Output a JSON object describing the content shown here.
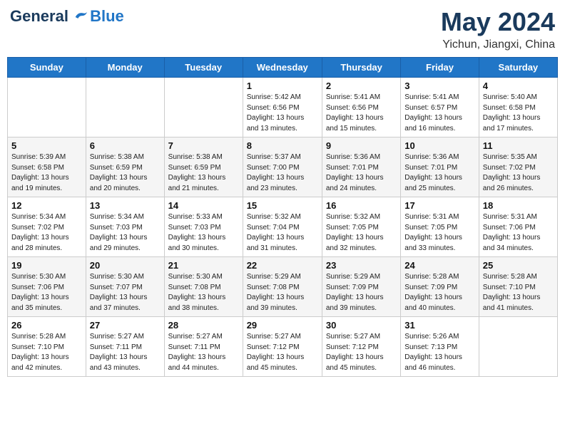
{
  "header": {
    "logo_line1": "General",
    "logo_line2": "Blue",
    "month": "May 2024",
    "location": "Yichun, Jiangxi, China"
  },
  "weekdays": [
    "Sunday",
    "Monday",
    "Tuesday",
    "Wednesday",
    "Thursday",
    "Friday",
    "Saturday"
  ],
  "weeks": [
    [
      {
        "day": "",
        "info": ""
      },
      {
        "day": "",
        "info": ""
      },
      {
        "day": "",
        "info": ""
      },
      {
        "day": "1",
        "info": "Sunrise: 5:42 AM\nSunset: 6:56 PM\nDaylight: 13 hours\nand 13 minutes."
      },
      {
        "day": "2",
        "info": "Sunrise: 5:41 AM\nSunset: 6:56 PM\nDaylight: 13 hours\nand 15 minutes."
      },
      {
        "day": "3",
        "info": "Sunrise: 5:41 AM\nSunset: 6:57 PM\nDaylight: 13 hours\nand 16 minutes."
      },
      {
        "day": "4",
        "info": "Sunrise: 5:40 AM\nSunset: 6:58 PM\nDaylight: 13 hours\nand 17 minutes."
      }
    ],
    [
      {
        "day": "5",
        "info": "Sunrise: 5:39 AM\nSunset: 6:58 PM\nDaylight: 13 hours\nand 19 minutes."
      },
      {
        "day": "6",
        "info": "Sunrise: 5:38 AM\nSunset: 6:59 PM\nDaylight: 13 hours\nand 20 minutes."
      },
      {
        "day": "7",
        "info": "Sunrise: 5:38 AM\nSunset: 6:59 PM\nDaylight: 13 hours\nand 21 minutes."
      },
      {
        "day": "8",
        "info": "Sunrise: 5:37 AM\nSunset: 7:00 PM\nDaylight: 13 hours\nand 23 minutes."
      },
      {
        "day": "9",
        "info": "Sunrise: 5:36 AM\nSunset: 7:01 PM\nDaylight: 13 hours\nand 24 minutes."
      },
      {
        "day": "10",
        "info": "Sunrise: 5:36 AM\nSunset: 7:01 PM\nDaylight: 13 hours\nand 25 minutes."
      },
      {
        "day": "11",
        "info": "Sunrise: 5:35 AM\nSunset: 7:02 PM\nDaylight: 13 hours\nand 26 minutes."
      }
    ],
    [
      {
        "day": "12",
        "info": "Sunrise: 5:34 AM\nSunset: 7:02 PM\nDaylight: 13 hours\nand 28 minutes."
      },
      {
        "day": "13",
        "info": "Sunrise: 5:34 AM\nSunset: 7:03 PM\nDaylight: 13 hours\nand 29 minutes."
      },
      {
        "day": "14",
        "info": "Sunrise: 5:33 AM\nSunset: 7:03 PM\nDaylight: 13 hours\nand 30 minutes."
      },
      {
        "day": "15",
        "info": "Sunrise: 5:32 AM\nSunset: 7:04 PM\nDaylight: 13 hours\nand 31 minutes."
      },
      {
        "day": "16",
        "info": "Sunrise: 5:32 AM\nSunset: 7:05 PM\nDaylight: 13 hours\nand 32 minutes."
      },
      {
        "day": "17",
        "info": "Sunrise: 5:31 AM\nSunset: 7:05 PM\nDaylight: 13 hours\nand 33 minutes."
      },
      {
        "day": "18",
        "info": "Sunrise: 5:31 AM\nSunset: 7:06 PM\nDaylight: 13 hours\nand 34 minutes."
      }
    ],
    [
      {
        "day": "19",
        "info": "Sunrise: 5:30 AM\nSunset: 7:06 PM\nDaylight: 13 hours\nand 35 minutes."
      },
      {
        "day": "20",
        "info": "Sunrise: 5:30 AM\nSunset: 7:07 PM\nDaylight: 13 hours\nand 37 minutes."
      },
      {
        "day": "21",
        "info": "Sunrise: 5:30 AM\nSunset: 7:08 PM\nDaylight: 13 hours\nand 38 minutes."
      },
      {
        "day": "22",
        "info": "Sunrise: 5:29 AM\nSunset: 7:08 PM\nDaylight: 13 hours\nand 39 minutes."
      },
      {
        "day": "23",
        "info": "Sunrise: 5:29 AM\nSunset: 7:09 PM\nDaylight: 13 hours\nand 39 minutes."
      },
      {
        "day": "24",
        "info": "Sunrise: 5:28 AM\nSunset: 7:09 PM\nDaylight: 13 hours\nand 40 minutes."
      },
      {
        "day": "25",
        "info": "Sunrise: 5:28 AM\nSunset: 7:10 PM\nDaylight: 13 hours\nand 41 minutes."
      }
    ],
    [
      {
        "day": "26",
        "info": "Sunrise: 5:28 AM\nSunset: 7:10 PM\nDaylight: 13 hours\nand 42 minutes."
      },
      {
        "day": "27",
        "info": "Sunrise: 5:27 AM\nSunset: 7:11 PM\nDaylight: 13 hours\nand 43 minutes."
      },
      {
        "day": "28",
        "info": "Sunrise: 5:27 AM\nSunset: 7:11 PM\nDaylight: 13 hours\nand 44 minutes."
      },
      {
        "day": "29",
        "info": "Sunrise: 5:27 AM\nSunset: 7:12 PM\nDaylight: 13 hours\nand 45 minutes."
      },
      {
        "day": "30",
        "info": "Sunrise: 5:27 AM\nSunset: 7:12 PM\nDaylight: 13 hours\nand 45 minutes."
      },
      {
        "day": "31",
        "info": "Sunrise: 5:26 AM\nSunset: 7:13 PM\nDaylight: 13 hours\nand 46 minutes."
      },
      {
        "day": "",
        "info": ""
      }
    ]
  ]
}
